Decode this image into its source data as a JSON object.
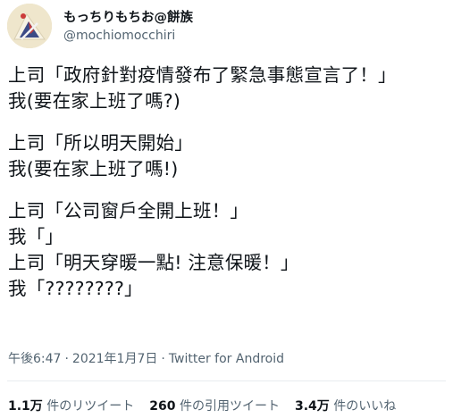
{
  "author": {
    "display_name": "もっちりもちお@餅族",
    "handle": "@mochiomocchiri",
    "avatar_icon": "avatar-image"
  },
  "tweet": {
    "lines": [
      "上司「政府針對疫情發布了緊急事態宣言了！」",
      "我(要在家上班了嗎?)",
      "",
      "上司「所以明天開始」",
      "我(要在家上班了嗎!)",
      "",
      "上司「公司窗戶全開上班！」",
      "我「」",
      "上司「明天穿暖一點! 注意保暖！」",
      "我「????????」"
    ]
  },
  "meta": {
    "time": "午後6:47",
    "separator": "·",
    "date": "2021年1月7日",
    "source": "Twitter for Android"
  },
  "stats": {
    "retweets_count": "1.1万",
    "retweets_label": "件のリツイート",
    "quotes_count": "260",
    "quotes_label": "件の引用ツイート",
    "likes_count": "3.4万",
    "likes_label": "件のいいね"
  },
  "colors": {
    "text": "#0f1419",
    "secondary": "#536471",
    "divider": "#e8ecef"
  }
}
